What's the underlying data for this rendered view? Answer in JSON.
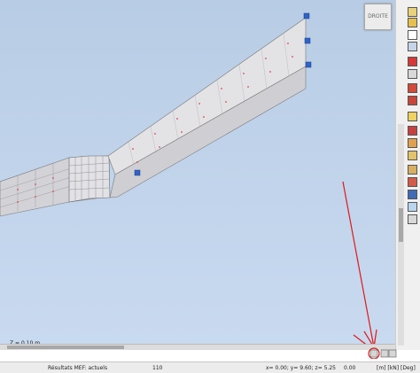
{
  "viewcube": {
    "label": "DROITE"
  },
  "viewport": {
    "z_level": "Z = 0.10 m"
  },
  "statusbar": {
    "fem_results": "Résultats MEF: actuels",
    "node_count": "110",
    "coords": "x= 0.00; y= 9.60; z= 5.25",
    "angle": "0.00",
    "units": "[m] [kN] [Deg]"
  },
  "colors": {
    "background": "#c3d5ec",
    "slab_fill": "#d2d2d6",
    "mesh_points": "#e0404c",
    "support_icon": "#2e62c8",
    "annotation": "#e01818"
  },
  "toolbar": {
    "icons": [
      "edit-icon",
      "edit-icon",
      "pencil-icon",
      "brush-icon",
      "bolt-icon",
      "section-icon",
      "fork-icon",
      "support-icon",
      "loads-icon",
      "cube-icon",
      "cube-icon",
      "results-icon",
      "export-icon",
      "measure-icon",
      "link-icon",
      "table-icon",
      "table-icon"
    ]
  }
}
